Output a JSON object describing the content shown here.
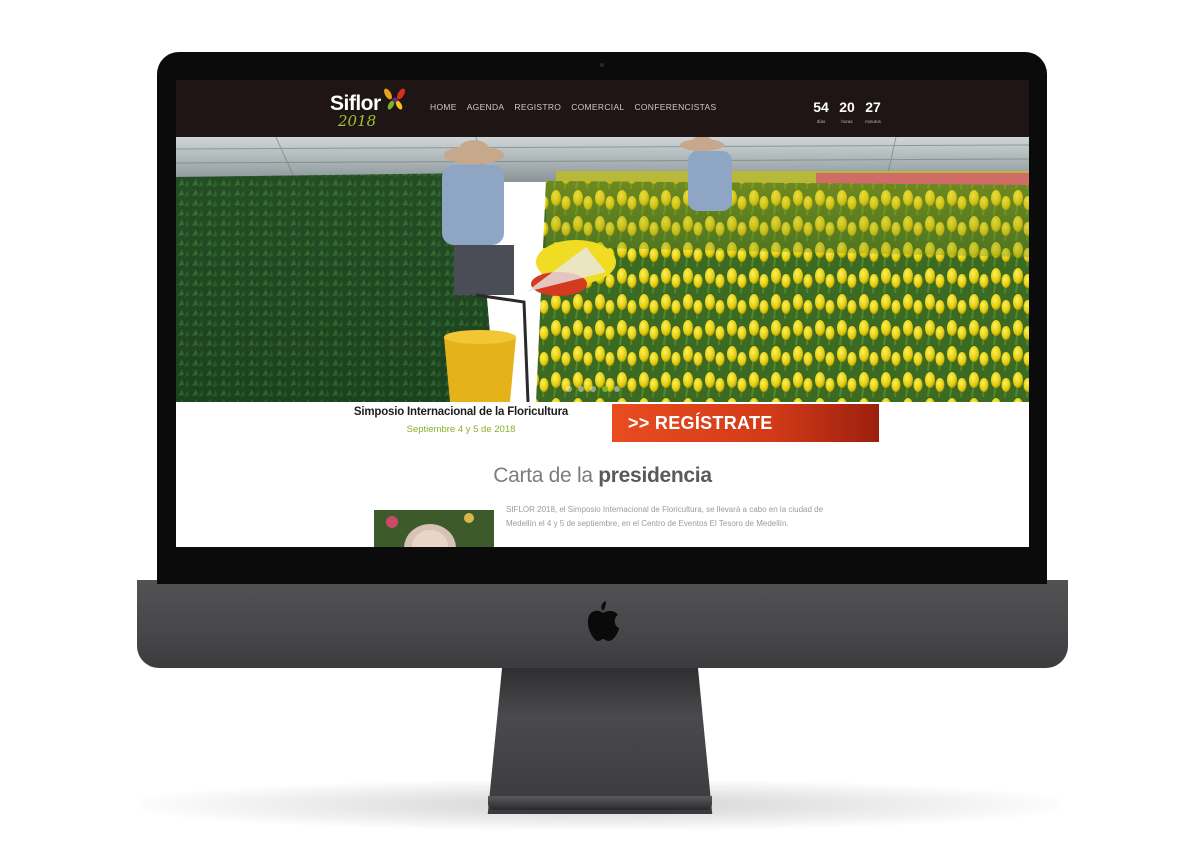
{
  "site": {
    "logo": {
      "name": "Siflor",
      "year": "2018"
    },
    "nav": {
      "items": [
        "HOME",
        "AGENDA",
        "REGISTRO",
        "COMERCIAL",
        "CONFERENCISTAS"
      ]
    },
    "countdown": [
      {
        "value": "54",
        "label": "días"
      },
      {
        "value": "20",
        "label": "horas"
      },
      {
        "value": "27",
        "label": "minutos"
      }
    ],
    "hero": {
      "slide_count": 5,
      "active_slide": 4
    },
    "event": {
      "title": "Simposio Internacional de la Floricultura",
      "date": "Septiembre 4 y 5 de 2018"
    },
    "register_button": ">> REGÍSTRATE",
    "letter": {
      "title_light": "Carta de la",
      "title_bold": "presidencia",
      "body": "SIFLOR 2018, el Simposio Internacional de Floricultura, se llevará a cabo en la ciudad de Medellín el 4 y 5 de septiembre, en el Centro de Eventos El Tesoro de Medellín."
    }
  },
  "colors": {
    "navbar": "#1e1514",
    "accent_green": "#8cb02b",
    "register_orange": "#e84c1f",
    "device_gray": "#47474a"
  }
}
